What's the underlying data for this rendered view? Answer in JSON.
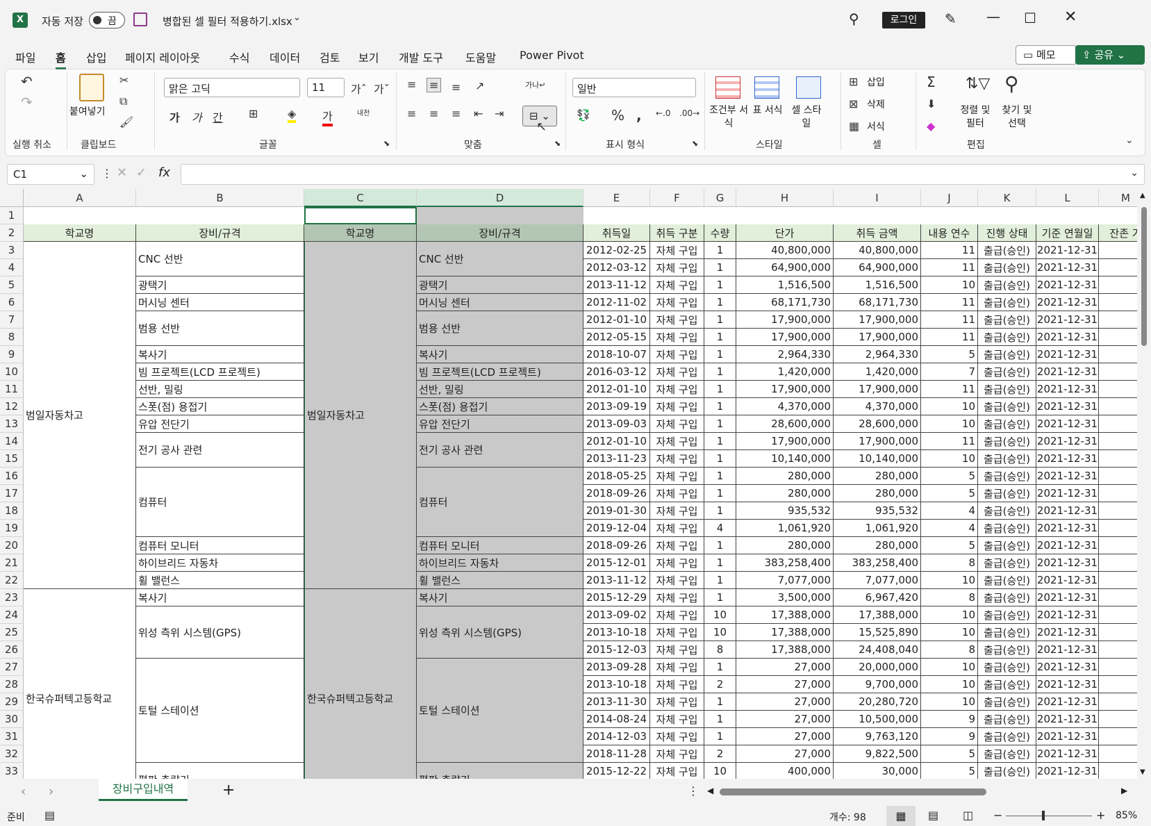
{
  "titlebar": {
    "autosave": "자동 저장",
    "toggle": "끔",
    "filename": "병합된 셀 필터 적용하기.xlsx",
    "login": "로그인"
  },
  "tabs": [
    "파일",
    "홈",
    "삽입",
    "페이지 레이아웃",
    "수식",
    "데이터",
    "검토",
    "보기",
    "개발 도구",
    "도움말",
    "Power Pivot"
  ],
  "memo": "메모",
  "share": "공유",
  "ribbon": {
    "undo_group": "실행 취소",
    "clipboard_group": "클립보드",
    "paste": "붙여넣기",
    "font_group": "글꼴",
    "font_name": "맑은 고딕",
    "font_size": "11",
    "align_group": "맞춤",
    "number_group": "표시 형식",
    "number_format": "일반",
    "style_group": "스타일",
    "cond_format": "조건부 서식",
    "table_format": "표 서식",
    "cell_style": "셀 스타일",
    "cells_group": "셀",
    "insert": "삽입",
    "delete": "삭제",
    "format": "서식",
    "edit_group": "편집",
    "sort_filter": "정렬 및 필터",
    "find_select": "찾기 및 선택"
  },
  "namebox": "C1",
  "columns": [
    "A",
    "B",
    "C",
    "D",
    "E",
    "F",
    "G",
    "H",
    "I",
    "J",
    "K",
    "L",
    "M"
  ],
  "headers": [
    "학교명",
    "장비/규격",
    "학교명",
    "장비/규격",
    "취득일",
    "취득 구분",
    "수량",
    "단가",
    "취득 금액",
    "내용 연수",
    "진행 상태",
    "기준 연월일",
    "잔존 가"
  ],
  "schools": [
    "범일자동차고",
    "한국슈퍼텍고등학교"
  ],
  "equip": [
    "CNC 선반",
    "광택기",
    "머시닝 센터",
    "범용 선반",
    "복사기",
    "빔 프로젝트(LCD 프로젝트)",
    "선반, 밀링",
    "스폿(점) 용접기",
    "유압 전단기",
    "전기 공사 관련",
    "컴퓨터",
    "컴퓨터 모니터",
    "하이브리드 자동차",
    "휠 밸런스",
    "복사기",
    "위성 측위 시스템(GPS)",
    "토털 스테이션",
    "평판 측량기"
  ],
  "rows": [
    [
      "2012-02-25",
      "자체 구입",
      "1",
      "40,800,000",
      "40,800,000",
      "11",
      "출급(승인)",
      "2021-12-31"
    ],
    [
      "2012-03-12",
      "자체 구입",
      "1",
      "64,900,000",
      "64,900,000",
      "11",
      "출급(승인)",
      "2021-12-31"
    ],
    [
      "2013-11-12",
      "자체 구입",
      "1",
      "1,516,500",
      "1,516,500",
      "10",
      "출급(승인)",
      "2021-12-31"
    ],
    [
      "2012-11-02",
      "자체 구입",
      "1",
      "68,171,730",
      "68,171,730",
      "11",
      "출급(승인)",
      "2021-12-31"
    ],
    [
      "2012-01-10",
      "자체 구입",
      "1",
      "17,900,000",
      "17,900,000",
      "11",
      "출급(승인)",
      "2021-12-31"
    ],
    [
      "2012-05-15",
      "자체 구입",
      "1",
      "17,900,000",
      "17,900,000",
      "11",
      "출급(승인)",
      "2021-12-31"
    ],
    [
      "2018-10-07",
      "자체 구입",
      "1",
      "2,964,330",
      "2,964,330",
      "5",
      "출급(승인)",
      "2021-12-31"
    ],
    [
      "2016-03-12",
      "자체 구입",
      "1",
      "1,420,000",
      "1,420,000",
      "7",
      "출급(승인)",
      "2021-12-31"
    ],
    [
      "2012-01-10",
      "자체 구입",
      "1",
      "17,900,000",
      "17,900,000",
      "11",
      "출급(승인)",
      "2021-12-31"
    ],
    [
      "2013-09-19",
      "자체 구입",
      "1",
      "4,370,000",
      "4,370,000",
      "10",
      "출급(승인)",
      "2021-12-31"
    ],
    [
      "2013-09-03",
      "자체 구입",
      "1",
      "28,600,000",
      "28,600,000",
      "10",
      "출급(승인)",
      "2021-12-31"
    ],
    [
      "2012-01-10",
      "자체 구입",
      "1",
      "17,900,000",
      "17,900,000",
      "11",
      "출급(승인)",
      "2021-12-31"
    ],
    [
      "2013-11-23",
      "자체 구입",
      "1",
      "10,140,000",
      "10,140,000",
      "10",
      "출급(승인)",
      "2021-12-31"
    ],
    [
      "2018-05-25",
      "자체 구입",
      "1",
      "280,000",
      "280,000",
      "5",
      "출급(승인)",
      "2021-12-31"
    ],
    [
      "2018-09-26",
      "자체 구입",
      "1",
      "280,000",
      "280,000",
      "5",
      "출급(승인)",
      "2021-12-31"
    ],
    [
      "2019-01-30",
      "자체 구입",
      "1",
      "935,532",
      "935,532",
      "4",
      "출급(승인)",
      "2021-12-31"
    ],
    [
      "2019-12-04",
      "자체 구입",
      "4",
      "1,061,920",
      "1,061,920",
      "4",
      "출급(승인)",
      "2021-12-31"
    ],
    [
      "2018-09-26",
      "자체 구입",
      "1",
      "280,000",
      "280,000",
      "5",
      "출급(승인)",
      "2021-12-31"
    ],
    [
      "2015-12-01",
      "자체 구입",
      "1",
      "383,258,400",
      "383,258,400",
      "8",
      "출급(승인)",
      "2021-12-31"
    ],
    [
      "2013-11-12",
      "자체 구입",
      "1",
      "7,077,000",
      "7,077,000",
      "10",
      "출급(승인)",
      "2021-12-31"
    ],
    [
      "2015-12-29",
      "자체 구입",
      "1",
      "3,500,000",
      "6,967,420",
      "8",
      "출급(승인)",
      "2021-12-31"
    ],
    [
      "2013-09-02",
      "자체 구입",
      "10",
      "17,388,000",
      "17,388,000",
      "10",
      "출급(승인)",
      "2021-12-31"
    ],
    [
      "2013-10-18",
      "자체 구입",
      "10",
      "17,388,000",
      "15,525,890",
      "10",
      "출급(승인)",
      "2021-12-31"
    ],
    [
      "2015-12-03",
      "자체 구입",
      "8",
      "17,388,000",
      "24,408,040",
      "8",
      "출급(승인)",
      "2021-12-31"
    ],
    [
      "2013-09-28",
      "자체 구입",
      "1",
      "27,000",
      "20,000,000",
      "10",
      "출급(승인)",
      "2021-12-31"
    ],
    [
      "2013-10-18",
      "자체 구입",
      "2",
      "27,000",
      "9,700,000",
      "10",
      "출급(승인)",
      "2021-12-31"
    ],
    [
      "2013-11-30",
      "자체 구입",
      "1",
      "27,000",
      "20,280,720",
      "10",
      "출급(승인)",
      "2021-12-31"
    ],
    [
      "2014-08-24",
      "자체 구입",
      "1",
      "27,000",
      "10,500,000",
      "9",
      "출급(승인)",
      "2021-12-31"
    ],
    [
      "2014-12-03",
      "자체 구입",
      "1",
      "27,000",
      "9,763,120",
      "9",
      "출급(승인)",
      "2021-12-31"
    ],
    [
      "2018-11-28",
      "자체 구입",
      "2",
      "27,000",
      "9,822,500",
      "5",
      "출급(승인)",
      "2021-12-31"
    ],
    [
      "2015-12-22",
      "자체 구입",
      "10",
      "400,000",
      "30,000",
      "5",
      "출급(승인)",
      "2021-12-31"
    ]
  ],
  "sheet_tab": "장비구입내역",
  "status": {
    "ready": "준비",
    "count": "개수: 98",
    "zoom": "85%"
  },
  "colors": {
    "excel_green": "#217346",
    "header_fill": "#e2efda",
    "selected_fill": "#c9c9c9",
    "selected_header": "#b3c6b3"
  }
}
